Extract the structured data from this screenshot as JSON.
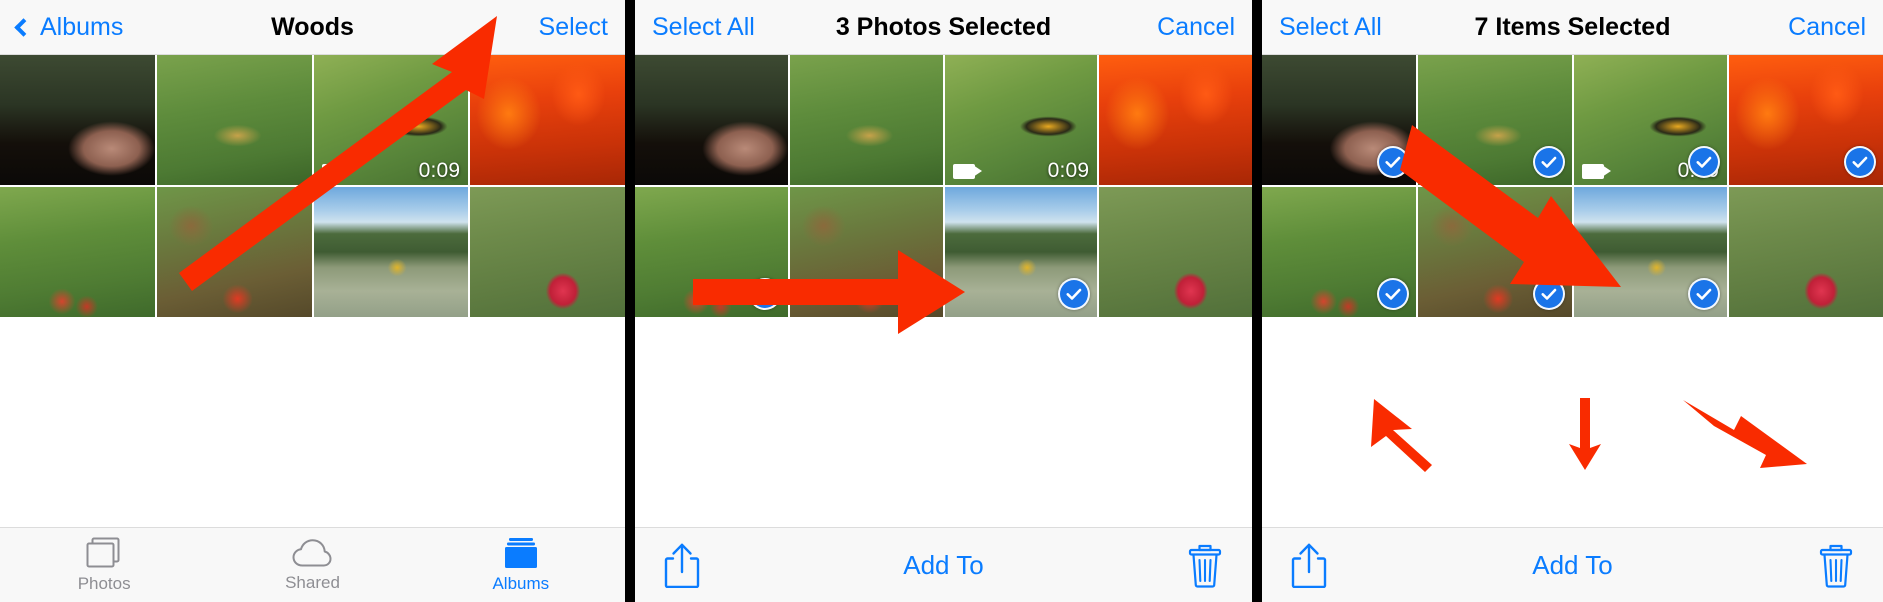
{
  "meta": {
    "accent_blue": "#0a7cff",
    "check_blue": "#1a74e8",
    "arrow_red": "#f92b00",
    "bar_bg": "#f8f8f8",
    "divider_black": "#000000",
    "inactive_gray": "#8e8e93"
  },
  "panels": [
    {
      "id": "panel-album-view",
      "navbar": {
        "back_label": "Albums",
        "back_icon": "chevron-left-icon",
        "title": "Woods",
        "action_label": "Select"
      },
      "grid": {
        "columns": 4,
        "rows": 2,
        "cells": [
          {
            "name": "photo-forest-mushrooms",
            "selected": false,
            "video": false
          },
          {
            "name": "photo-grass-salamander",
            "selected": false,
            "video": false
          },
          {
            "name": "video-salamander-grass",
            "selected": false,
            "video": true,
            "duration": "0:09",
            "video_icon": "video-camera-icon"
          },
          {
            "name": "photo-autumn-foliage",
            "selected": false,
            "video": false
          },
          {
            "name": "photo-moss-red-mushrooms",
            "selected": false,
            "video": false
          },
          {
            "name": "photo-forest-floor-amanita",
            "selected": false,
            "video": false
          },
          {
            "name": "photo-golden-pavilion-lake",
            "selected": false,
            "video": false
          },
          {
            "name": "photo-red-amanita-twigs",
            "selected": false,
            "video": false
          }
        ]
      },
      "tabbar": {
        "items": [
          {
            "label": "Photos",
            "icon": "photos-stack-icon",
            "active": false
          },
          {
            "label": "Shared",
            "icon": "cloud-icon",
            "active": false
          },
          {
            "label": "Albums",
            "icon": "albums-folder-icon",
            "active": true
          }
        ]
      },
      "annotations": [
        {
          "name": "arrow-to-select-button",
          "type": "arrow-diagonal-up-right"
        }
      ]
    },
    {
      "id": "panel-3-selected",
      "navbar": {
        "back_label": "Select All",
        "title": "3 Photos Selected",
        "action_label": "Cancel"
      },
      "grid": {
        "columns": 4,
        "rows": 2,
        "cells": [
          {
            "name": "photo-forest-mushrooms",
            "selected": false,
            "video": false
          },
          {
            "name": "photo-grass-salamander",
            "selected": false,
            "video": false
          },
          {
            "name": "video-salamander-grass",
            "selected": false,
            "video": true,
            "duration": "0:09",
            "video_icon": "video-camera-icon"
          },
          {
            "name": "photo-autumn-foliage",
            "selected": false,
            "video": false
          },
          {
            "name": "photo-moss-red-mushrooms",
            "selected": true,
            "video": false,
            "check_icon": "checkmark-circle-icon"
          },
          {
            "name": "photo-forest-floor-amanita",
            "selected": true,
            "video": false,
            "check_icon": "checkmark-circle-icon"
          },
          {
            "name": "photo-golden-pavilion-lake",
            "selected": true,
            "video": false,
            "check_icon": "checkmark-circle-icon"
          },
          {
            "name": "photo-red-amanita-twigs",
            "selected": false,
            "video": false
          }
        ]
      },
      "toolbar": {
        "share_icon": "share-upload-icon",
        "add_to_label": "Add To",
        "trash_icon": "trash-can-icon"
      },
      "annotations": [
        {
          "name": "arrow-to-selected-thumbnails",
          "type": "arrow-right"
        }
      ]
    },
    {
      "id": "panel-7-selected",
      "navbar": {
        "back_label": "Select All",
        "title": "7 Items Selected",
        "action_label": "Cancel"
      },
      "grid": {
        "columns": 4,
        "rows": 2,
        "cells": [
          {
            "name": "photo-forest-mushrooms",
            "selected": true,
            "video": false,
            "check_icon": "checkmark-circle-icon"
          },
          {
            "name": "photo-grass-salamander",
            "selected": true,
            "video": false,
            "check_icon": "checkmark-circle-icon"
          },
          {
            "name": "video-salamander-grass",
            "selected": true,
            "video": true,
            "duration": "0:09",
            "video_icon": "video-camera-icon",
            "check_icon": "checkmark-circle-icon"
          },
          {
            "name": "photo-autumn-foliage",
            "selected": true,
            "video": false,
            "check_icon": "checkmark-circle-icon"
          },
          {
            "name": "photo-moss-red-mushrooms",
            "selected": true,
            "video": false,
            "check_icon": "checkmark-circle-icon"
          },
          {
            "name": "photo-forest-floor-amanita",
            "selected": true,
            "video": false,
            "check_icon": "checkmark-circle-icon"
          },
          {
            "name": "photo-golden-pavilion-lake",
            "selected": true,
            "video": false,
            "check_icon": "checkmark-circle-icon"
          },
          {
            "name": "photo-red-amanita-twigs",
            "selected": false,
            "video": false
          }
        ]
      },
      "toolbar": {
        "share_icon": "share-upload-icon",
        "add_to_label": "Add To",
        "trash_icon": "trash-can-icon"
      },
      "annotations": [
        {
          "name": "arrow-to-selected-thumbnails",
          "type": "arrow-diagonal-down-right"
        },
        {
          "name": "arrow-to-share-button",
          "type": "arrow-diagonal-down-left"
        },
        {
          "name": "arrow-to-add-to-button",
          "type": "arrow-down"
        },
        {
          "name": "arrow-to-trash-button",
          "type": "arrow-diagonal-down-right-small"
        }
      ]
    }
  ]
}
